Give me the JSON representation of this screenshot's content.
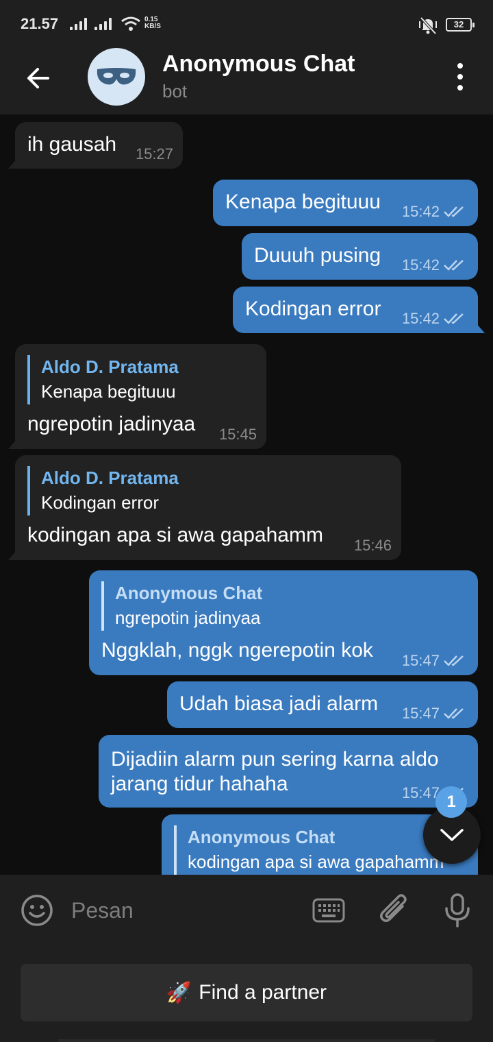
{
  "status_bar": {
    "time": "21.57",
    "net_speed_value": "0.15",
    "net_speed_unit": "KB/S",
    "battery": "32"
  },
  "header": {
    "title": "Anonymous Chat",
    "subtitle": "bot",
    "avatar_icon": "mask-icon"
  },
  "messages": [
    {
      "direction": "in",
      "text": "ih gausah",
      "time": "15:27"
    },
    {
      "direction": "out",
      "text": "Kenapa begituuu",
      "time": "15:42",
      "status": "read"
    },
    {
      "direction": "out",
      "text": "Duuuh pusing",
      "time": "15:42",
      "status": "read"
    },
    {
      "direction": "out",
      "text": "Kodingan error",
      "time": "15:42",
      "status": "read"
    },
    {
      "direction": "in",
      "reply_name": "Aldo D. Pratama",
      "reply_text": "Kenapa begituuu",
      "text": "ngrepotin jadinyaa",
      "time": "15:45"
    },
    {
      "direction": "in",
      "reply_name": "Aldo D. Pratama",
      "reply_text": "Kodingan error",
      "text": "kodingan apa si awa gapahamm",
      "time": "15:46"
    },
    {
      "direction": "out",
      "reply_name": "Anonymous Chat",
      "reply_text": "ngrepotin jadinyaa",
      "text": "Nggklah, nggk ngerepotin kok",
      "time": "15:47",
      "status": "read"
    },
    {
      "direction": "out",
      "text": "Udah biasa jadi alarm",
      "time": "15:47",
      "status": "read"
    },
    {
      "direction": "out",
      "text": "Dijadiin alarm pun sering karna aldo jarang tidur hahaha",
      "time": "15:47",
      "status": "read"
    },
    {
      "direction": "out",
      "reply_name": "Anonymous Chat",
      "reply_text": "kodingan apa si awa gapahamm"
    }
  ],
  "scroll_badge": "1",
  "input": {
    "placeholder": "Pesan"
  },
  "bot_keyboard": {
    "button_emoji": "🚀",
    "button_label": "Find a partner"
  },
  "colors": {
    "outgoing_bubble": "#3a7abf",
    "incoming_bubble": "#222222",
    "reply_name_incoming": "#72b6f0",
    "background": "#0e0e0e",
    "bar": "#1f1f1f"
  }
}
